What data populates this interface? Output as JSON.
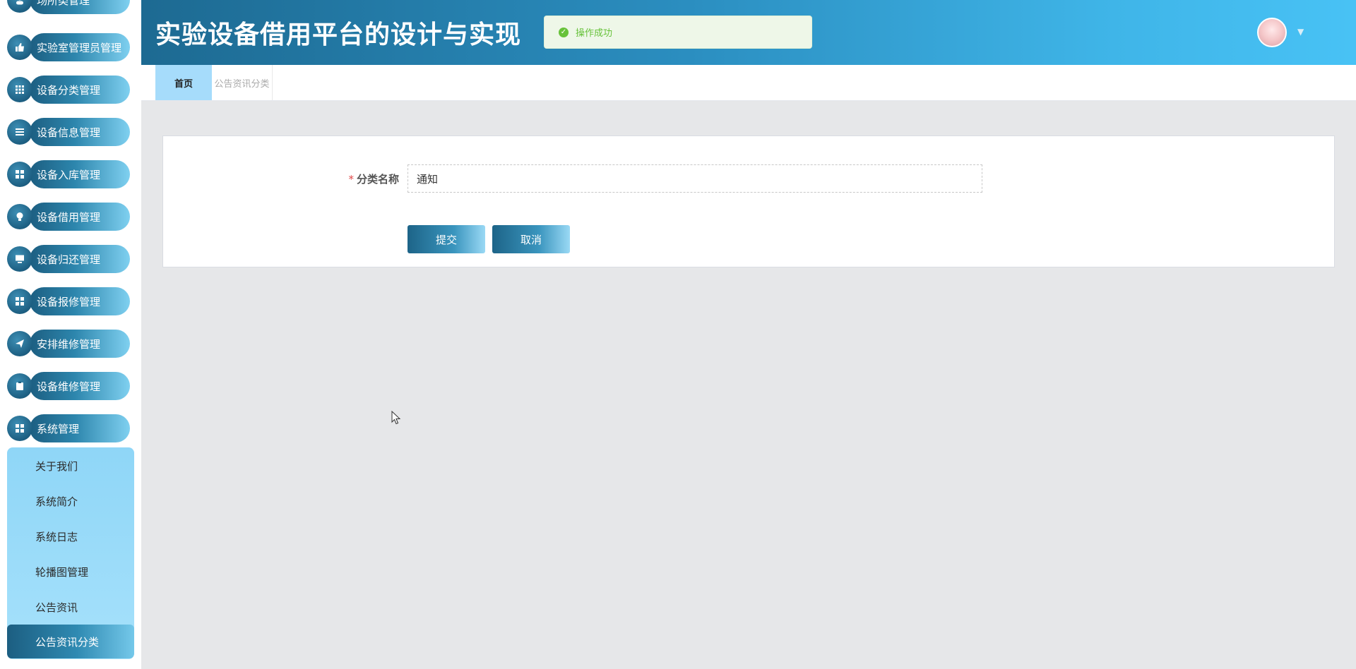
{
  "sidebar": {
    "items": [
      {
        "label": "场所类管理",
        "icon": "user-icon"
      },
      {
        "label": "实验室管理员管理",
        "icon": "thumbs-up-icon"
      },
      {
        "label": "设备分类管理",
        "icon": "grid-icon"
      },
      {
        "label": "设备信息管理",
        "icon": "list-icon"
      },
      {
        "label": "设备入库管理",
        "icon": "apps-icon"
      },
      {
        "label": "设备借用管理",
        "icon": "bulb-icon"
      },
      {
        "label": "设备归还管理",
        "icon": "monitor-icon"
      },
      {
        "label": "设备报修管理",
        "icon": "apps-icon"
      },
      {
        "label": "安排维修管理",
        "icon": "send-icon"
      },
      {
        "label": "设备维修管理",
        "icon": "clipboard-icon"
      },
      {
        "label": "系统管理",
        "icon": "apps-icon"
      }
    ],
    "submenu": [
      {
        "label": "关于我们"
      },
      {
        "label": "系统简介"
      },
      {
        "label": "系统日志"
      },
      {
        "label": "轮播图管理"
      },
      {
        "label": "公告资讯"
      },
      {
        "label": "公告资讯分类"
      }
    ]
  },
  "header": {
    "title": "实验设备借用平台的设计与实现",
    "toast": "操作成功"
  },
  "tabs": [
    {
      "label": "首页"
    },
    {
      "label": "公告资讯分类"
    }
  ],
  "form": {
    "label": "分类名称",
    "required_mark": "*",
    "value": "通知",
    "submit_label": "提交",
    "cancel_label": "取消"
  },
  "colors": {
    "accent": "#1d6a92",
    "header_end": "#48c2f5",
    "submenu_bg": "#a6e1fb",
    "toast_text": "#67c23a"
  }
}
